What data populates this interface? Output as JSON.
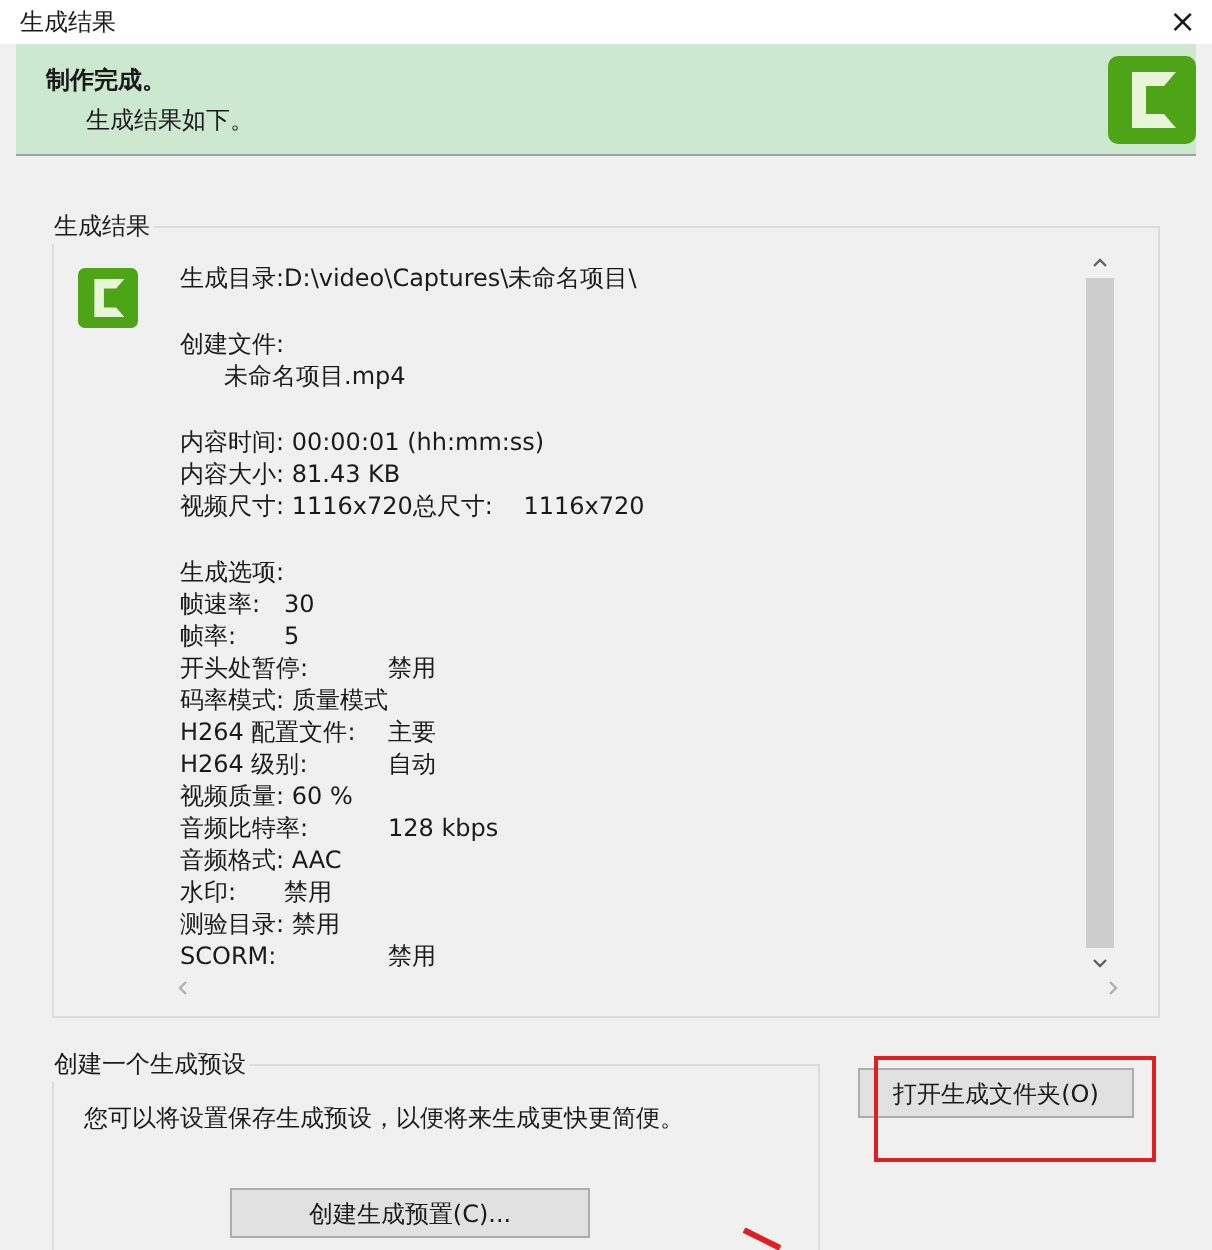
{
  "window": {
    "title": "生成结果",
    "close": "×"
  },
  "banner": {
    "title": "制作完成。",
    "subtitle": "生成结果如下。"
  },
  "results": {
    "legend": "生成结果",
    "lines": [
      {
        "kind": "text",
        "text": "生成目录:D:\\video\\Captures\\未命名项目\\"
      },
      {
        "kind": "gap"
      },
      {
        "kind": "text",
        "text": "创建文件:"
      },
      {
        "kind": "indent",
        "text": "未命名项目.mp4"
      },
      {
        "kind": "gap"
      },
      {
        "kind": "text",
        "text": "内容时间: 00:00:01 (hh:mm:ss)"
      },
      {
        "kind": "text",
        "text": "内容大小: 81.43 KB"
      },
      {
        "kind": "text",
        "text": "视频尺寸: 1116x720总尺寸:    1116x720"
      },
      {
        "kind": "gap"
      },
      {
        "kind": "text",
        "text": "生成选项:"
      },
      {
        "kind": "pair_short",
        "label": "帧速率:",
        "value": "30"
      },
      {
        "kind": "pair_short",
        "label": "帧率:",
        "value": "5"
      },
      {
        "kind": "pair_wide",
        "label": "开头处暂停:",
        "value": "禁用"
      },
      {
        "kind": "text",
        "text": "码率模式: 质量模式"
      },
      {
        "kind": "pair_wide",
        "label": "H264 配置文件:",
        "value": "主要"
      },
      {
        "kind": "pair_wide",
        "label": "H264 级别:",
        "value": "自动"
      },
      {
        "kind": "text",
        "text": "视频质量: 60 %"
      },
      {
        "kind": "pair_wide",
        "label": "音频比特率:",
        "value": "128 kbps"
      },
      {
        "kind": "text",
        "text": "音频格式: AAC"
      },
      {
        "kind": "pair_short",
        "label": "水印:",
        "value": "禁用"
      },
      {
        "kind": "text",
        "text": "测验目录: 禁用"
      },
      {
        "kind": "pair_wide",
        "label": "SCORM:",
        "value": "禁用"
      }
    ]
  },
  "preset": {
    "legend": "创建一个生成预设",
    "description": "您可以将设置保存生成预设，以便将来生成更快更简便。",
    "button": "创建生成预置(C)..."
  },
  "open_folder_button": {
    "label": "打开生成文件夹(O)",
    "highlighted": true
  }
}
